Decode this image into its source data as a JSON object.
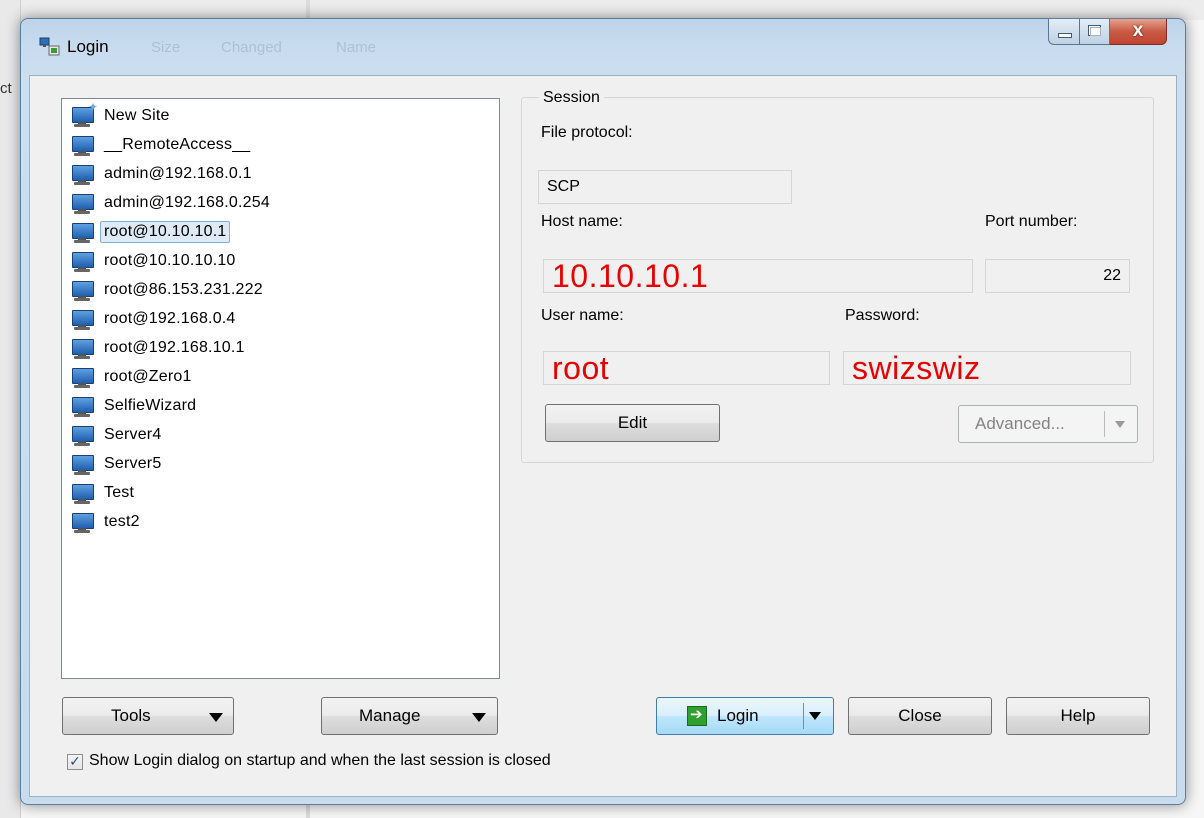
{
  "background": {
    "fragment_text": "ct"
  },
  "window": {
    "title": "Login",
    "ghost_header_1": "Size",
    "ghost_header_2": "Changed",
    "ghost_header_3": "Name",
    "close_glyph": "x"
  },
  "sites": [
    {
      "label": "New Site",
      "icon": "new-site-icon",
      "selected": false
    },
    {
      "label": "__RemoteAccess__",
      "icon": "monitor-icon",
      "selected": false
    },
    {
      "label": "admin@192.168.0.1",
      "icon": "monitor-icon",
      "selected": false
    },
    {
      "label": "admin@192.168.0.254",
      "icon": "monitor-icon",
      "selected": false
    },
    {
      "label": "root@10.10.10.1",
      "icon": "monitor-icon",
      "selected": true
    },
    {
      "label": "root@10.10.10.10",
      "icon": "monitor-icon",
      "selected": false
    },
    {
      "label": "root@86.153.231.222",
      "icon": "monitor-icon",
      "selected": false
    },
    {
      "label": "root@192.168.0.4",
      "icon": "monitor-icon",
      "selected": false
    },
    {
      "label": "root@192.168.10.1",
      "icon": "monitor-icon",
      "selected": false
    },
    {
      "label": "root@Zero1",
      "icon": "monitor-icon",
      "selected": false
    },
    {
      "label": "SelfieWizard",
      "icon": "monitor-icon",
      "selected": false
    },
    {
      "label": "Server4",
      "icon": "monitor-icon",
      "selected": false
    },
    {
      "label": "Server5",
      "icon": "monitor-icon",
      "selected": false
    },
    {
      "label": "Test",
      "icon": "monitor-icon",
      "selected": false
    },
    {
      "label": "test2",
      "icon": "monitor-icon",
      "selected": false
    }
  ],
  "session": {
    "group_label": "Session",
    "file_protocol_label": "File protocol:",
    "file_protocol_value": "SCP",
    "host_label": "Host name:",
    "host_value": "10.10.10.1",
    "port_label": "Port number:",
    "port_value": "22",
    "user_label": "User name:",
    "user_value": "root",
    "password_label": "Password:",
    "password_value": "swizswiz",
    "edit_label": "Edit",
    "advanced_label": "Advanced..."
  },
  "buttons": {
    "tools": "Tools",
    "manage": "Manage",
    "login": "Login",
    "close": "Close",
    "help": "Help"
  },
  "startup_checkbox": {
    "label": "Show Login dialog on startup and when the last session is closed",
    "checked": true
  },
  "colors": {
    "annotation_red": "#e60000",
    "selection_bg": "#dfeaf7",
    "window_frame": "#c9dcef"
  }
}
